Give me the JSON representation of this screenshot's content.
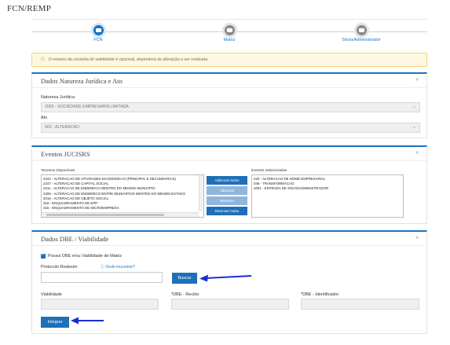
{
  "page": {
    "title": "FCN/REMP"
  },
  "steps": [
    {
      "label": "FCN",
      "state": "active"
    },
    {
      "label": "Matriz",
      "state": "inactive"
    },
    {
      "label": "Sócio/Administrador",
      "state": "inactive"
    }
  ],
  "alert": {
    "text": "O número da consulta de viabilidade é opcional, dependerá da alteração a ser realizada."
  },
  "natureza": {
    "title": "Dados Natureza Jurídica e Ato",
    "natureza_label": "Natureza Jurídica",
    "natureza_value": "2062 - SOCIEDADE EMPRESARIA LIMITADA",
    "ato_label": "Ato",
    "ato_value": "002 - ALTERACAO"
  },
  "eventos": {
    "title": "Eventos JUCISRS",
    "disponiveis_label": "*Eventos Disponíveis",
    "selecionados_label": "Eventos Selecionados",
    "disponiveis": [
      "2244 - ALTERACAO DE ATIVIDADES ECONOMICAS (PRINCIPAL E SECUNDARIAS)",
      "2247 - ALTERACAO DE CAPITAL SOCIAL",
      "2211 - ALTERACAO DE ENDERECO DENTRO DO MESMO MUNICIPIO",
      "2205 - ALTERACAO DE ENDERECO ENTRE MUNICIPIOS DENTRO DO MESMO ESTADO",
      "2015 - ALTERACAO DE OBJETO SOCIAL",
      "316 - ENQUADRAMENTO DE EPP",
      "315 - ENQUADRAMENTO DE MICROEMPRESA"
    ],
    "selecionados": [
      "220 - ALTERACAO DE NOME EMPRESARIAL",
      "046 - TRANSFORMACAO",
      "2001 - ENTRADA DE SOCIO/ADMINISTRADOR"
    ],
    "buttons": {
      "add_all": "Adicionar todos",
      "add": "Adicionar",
      "remove": "Remover",
      "remove_all": "Remover todos"
    }
  },
  "dbe": {
    "title": "Dados DBE / Viabilidade",
    "checkbox_label": "Possui DBE e/ou Viabilidade de Matriz",
    "protocolo_label": "Protocolo Redesim",
    "help_text": "Onde encontrar?",
    "buscar": "Buscar",
    "viabilidade_label": "Viabilidade",
    "recibo_label": "*DBE - Recibo",
    "identificador_label": "*DBE - Identificador",
    "integrar": "Integrar"
  },
  "icons": {
    "collapse": "collapse-chevron-icon",
    "warning": "warning-icon",
    "help": "info-icon"
  },
  "colors": {
    "accent": "#1a73c4",
    "arrow": "#1b2fd1",
    "alert_bg": "#fcf8e3"
  }
}
